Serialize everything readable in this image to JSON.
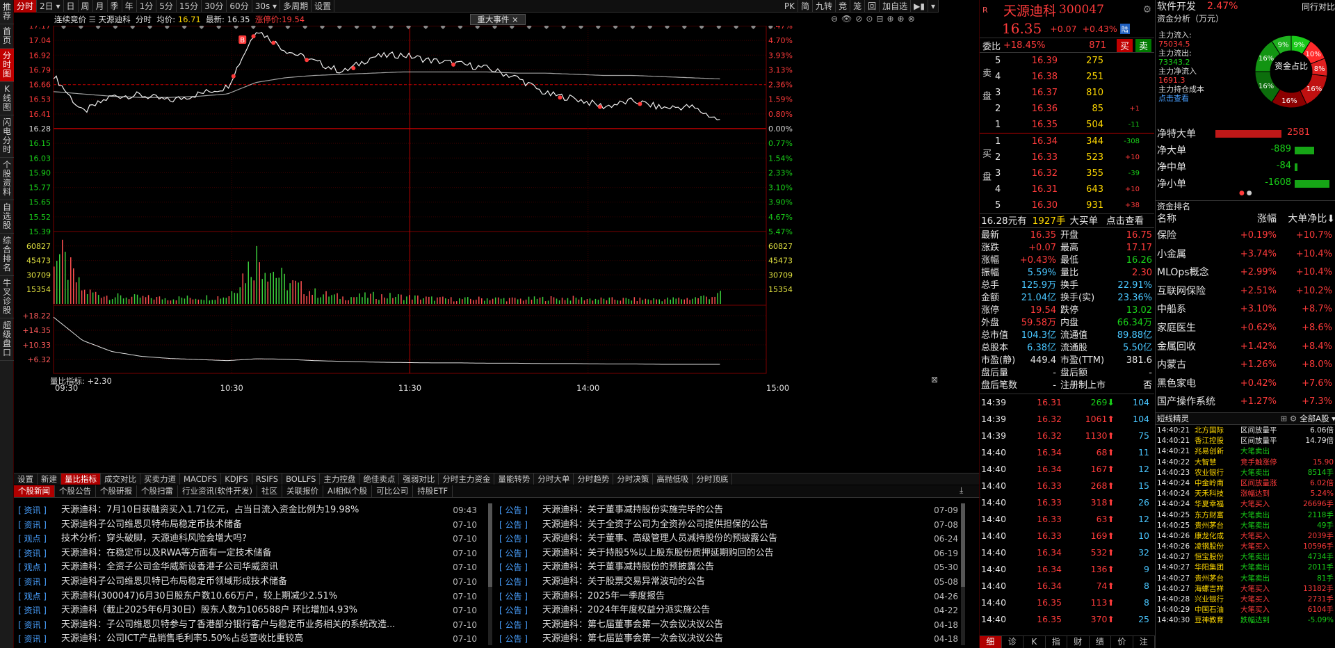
{
  "left_nav": [
    "推荐",
    "首页",
    "分时图",
    "K线图",
    "闪电分时",
    "个股资料",
    "自选股",
    "综合排名",
    "牛叉诊股",
    "超级盘口"
  ],
  "left_nav_active": 2,
  "topbar": {
    "tabs": [
      "分时",
      "2日",
      "日",
      "周",
      "月",
      "季",
      "年",
      "1分",
      "5分",
      "15分",
      "30分",
      "60分",
      "30s",
      "多周期",
      "设置"
    ],
    "active": 0,
    "right_tools": [
      "PK",
      "简",
      "九转",
      "竞",
      "笼",
      "回",
      "加自选"
    ]
  },
  "chart_info": {
    "mode": "连续竞价",
    "stock": "天源迪科",
    "label": "分时",
    "avg_label": "均价:",
    "avg": "16.71",
    "last_label": "最新:",
    "last": "16.35",
    "limit_label": "涨停价:",
    "limit": "19.54",
    "event_tag": "重大事件"
  },
  "price_axis": {
    "left": [
      "17.17",
      "17.04",
      "16.92",
      "16.79",
      "16.66",
      "16.53",
      "16.41",
      "16.28",
      "16.15",
      "16.03",
      "15.90",
      "15.77",
      "15.65",
      "15.52",
      "15.39"
    ],
    "right": [
      "5.47%",
      "4.70%",
      "3.93%",
      "3.13%",
      "2.36%",
      "1.59%",
      "0.80%",
      "0.00%",
      "0.77%",
      "1.54%",
      "2.33%",
      "3.10%",
      "3.90%",
      "4.67%",
      "5.47%"
    ],
    "prev_close": 16.28,
    "ymin": 15.39,
    "ymax": 17.17
  },
  "volume_axis": {
    "labels": [
      "60827",
      "45473",
      "30709",
      "15354"
    ],
    "vmax": 80000
  },
  "volratio": {
    "label": "量比指标: +2.30",
    "axis": [
      "+18.22",
      "+14.35",
      "+10.33",
      "+6.32"
    ]
  },
  "time_axis": [
    "09:30",
    "10:30",
    "11:30",
    "14:00",
    "15:00"
  ],
  "chart_data": {
    "type": "line",
    "x": [
      "09:30",
      "09:40",
      "09:50",
      "10:00",
      "10:10",
      "10:20",
      "10:30",
      "10:40",
      "10:50",
      "11:00",
      "11:10",
      "11:20",
      "11:30",
      "13:10",
      "13:20",
      "13:30",
      "13:40",
      "13:50",
      "14:00",
      "14:10",
      "14:20",
      "14:30",
      "14:40",
      "14:50"
    ],
    "series": [
      {
        "values": [
          16.74,
          16.42,
          16.56,
          16.57,
          16.52,
          16.58,
          16.64,
          17.14,
          16.96,
          16.86,
          16.77,
          16.9,
          16.92,
          16.87,
          16.84,
          16.8,
          16.72,
          16.58,
          16.54,
          16.47,
          16.52,
          16.46,
          16.47,
          16.35
        ]
      },
      {
        "values": [
          16.6,
          16.58,
          16.56,
          16.55,
          16.55,
          16.56,
          16.58,
          16.68,
          16.72,
          16.74,
          16.75,
          16.76,
          16.77,
          16.77,
          16.77,
          16.77,
          16.76,
          16.76,
          16.75,
          16.74,
          16.74,
          16.73,
          16.72,
          16.71
        ]
      },
      {
        "values": [
          62000,
          14000,
          8000,
          7000,
          6000,
          7000,
          8000,
          52000,
          24000,
          12000,
          7000,
          9000,
          8000,
          6000,
          5000,
          6000,
          5000,
          6000,
          6000,
          5000,
          5000,
          5000,
          6000,
          10000
        ]
      },
      {
        "values": [
          17.8,
          11.5,
          8.5,
          7.2,
          6.6,
          6.3,
          6.0,
          6.5,
          6.4,
          6.0,
          5.8,
          5.6,
          5.5,
          5.4,
          5.4,
          5.3,
          5.3,
          5.2,
          5.2,
          5.1,
          5.1,
          5.0,
          5.0,
          5.0
        ]
      }
    ]
  },
  "bottom_tabs": [
    "设置",
    "新建",
    "量比指标",
    "成交对比",
    "买卖力道",
    "MACDFS",
    "KDJFS",
    "RSIFS",
    "BOLLFS",
    "主力控盘",
    "绝佳卖点",
    "强弱对比",
    "分时主力资金",
    "量能转势",
    "分时大单",
    "分时趋势",
    "分时决策",
    "高抛低吸",
    "分时顶底"
  ],
  "bottom_tabs_active": 2,
  "news_tabs": [
    "个股新闻",
    "个股公告",
    "个股研报",
    "个股扫雷",
    "行业资讯(软件开发)",
    "社区",
    "关联报价",
    "AI相似个股",
    "可比公司",
    "持股ETF"
  ],
  "news_left": [
    {
      "tag": "[ 资讯 ]",
      "title": "天源迪科：7月10日获融资买入1.71亿元，占当日流入资金比例为19.98%",
      "date": "09:43"
    },
    {
      "tag": "[ 资讯 ]",
      "title": "天源迪科子公司维恩贝特布局稳定币技术储备",
      "date": "07-10"
    },
    {
      "tag": "[ 观点 ]",
      "title": "技术分析：穿头破脚，天源迪科风险会增大吗？",
      "date": "07-10"
    },
    {
      "tag": "[ 资讯 ]",
      "title": "天源迪科：在稳定币以及RWA等方面有一定技术储备",
      "date": "07-10"
    },
    {
      "tag": "[ 观点 ]",
      "title": "天源迪科：全资子公司金华威新设香港子公司华威资讯",
      "date": "07-10"
    },
    {
      "tag": "[ 资讯 ]",
      "title": "天源迪科子公司维恩贝特已布局稳定币领域形成技术储备",
      "date": "07-10"
    },
    {
      "tag": "[ 观点 ]",
      "title": "天源迪科(300047)6月30日股东户数10.66万户，较上期减少2.51%",
      "date": "07-10"
    },
    {
      "tag": "[ 资讯 ]",
      "title": "天源迪科（截止2025年6月30日）股东人数为106588户 环比增加4.93%",
      "date": "07-10"
    },
    {
      "tag": "[ 资讯 ]",
      "title": "天源迪科：子公司维恩贝特参与了香港部分银行客户与稳定币业务相关的系统改造...",
      "date": "07-10"
    },
    {
      "tag": "[ 资讯 ]",
      "title": "天源迪科：公司ICT产品销售毛利率5.50%占总营收比重较高",
      "date": "07-10"
    }
  ],
  "news_right": [
    {
      "tag": "[ 公告 ]",
      "title": "天源迪科：关于董事减持股份实施完毕的公告",
      "date": "07-09"
    },
    {
      "tag": "[ 公告 ]",
      "title": "天源迪科：关于全资子公司为全资孙公司提供担保的公告",
      "date": "07-08"
    },
    {
      "tag": "[ 公告 ]",
      "title": "天源迪科：关于董事、高级管理人员减持股份的预披露公告",
      "date": "06-24"
    },
    {
      "tag": "[ 公告 ]",
      "title": "天源迪科：关于持股5%以上股东股份质押延期购回的公告",
      "date": "06-19"
    },
    {
      "tag": "[ 公告 ]",
      "title": "天源迪科：关于董事减持股份的预披露公告",
      "date": "05-30"
    },
    {
      "tag": "[ 公告 ]",
      "title": "天源迪科：关于股票交易异常波动的公告",
      "date": "05-08"
    },
    {
      "tag": "[ 公告 ]",
      "title": "天源迪科：2025年一季度报告",
      "date": "04-26"
    },
    {
      "tag": "[ 公告 ]",
      "title": "天源迪科：2024年年度权益分派实施公告",
      "date": "04-22"
    },
    {
      "tag": "[ 公告 ]",
      "title": "天源迪科：第七届董事会第一次会议决议公告",
      "date": "04-18"
    },
    {
      "tag": "[ 公告 ]",
      "title": "天源迪科：第七届监事会第一次会议决议公告",
      "date": "04-18"
    }
  ],
  "quote": {
    "name": "天源迪科",
    "code": "300047",
    "price": "16.35",
    "chg": "+0.07",
    "pct": "+0.43%",
    "badge": "陆",
    "wb_label": "委比",
    "wb": "+18.45%",
    "wc": "871",
    "buy": "买",
    "sell": "卖",
    "sell_side": "卖盘",
    "buy_side": "买盘",
    "asks": [
      [
        "5",
        "16.39",
        "275",
        ""
      ],
      [
        "4",
        "16.38",
        "251",
        ""
      ],
      [
        "3",
        "16.37",
        "810",
        ""
      ],
      [
        "2",
        "16.36",
        "85",
        "+1"
      ],
      [
        "1",
        "16.35",
        "504",
        "-11"
      ]
    ],
    "bids": [
      [
        "1",
        "16.34",
        "344",
        "-308"
      ],
      [
        "2",
        "16.33",
        "523",
        "+10"
      ],
      [
        "3",
        "16.32",
        "355",
        "-39"
      ],
      [
        "4",
        "16.31",
        "643",
        "+10"
      ],
      [
        "5",
        "16.30",
        "931",
        "+38"
      ]
    ],
    "bigbuy": "16.28元有",
    "bigvol": "1927手",
    "bigtxt": "大买单",
    "bigclick": "点击查看",
    "stats": [
      [
        "最新",
        "16.35",
        "开盘",
        "16.75"
      ],
      [
        "涨跌",
        "+0.07",
        "最高",
        "17.17"
      ],
      [
        "涨幅",
        "+0.43%",
        "最低",
        "16.26"
      ],
      [
        "振幅",
        "5.59%",
        "量比",
        "2.30"
      ],
      [
        "总手",
        "125.9万",
        "换手",
        "22.91%"
      ],
      [
        "金额",
        "21.04亿",
        "换手(实)",
        "23.36%"
      ],
      [
        "涨停",
        "19.54",
        "跌停",
        "13.02"
      ],
      [
        "外盘",
        "59.58万",
        "内盘",
        "66.34万"
      ],
      [
        "总市值",
        "104.3亿",
        "流通值",
        "89.88亿"
      ],
      [
        "总股本",
        "6.38亿",
        "流通股",
        "5.50亿"
      ],
      [
        "市盈(静)",
        "449.4",
        "市盈(TTM)",
        "381.6"
      ],
      [
        "盘后量",
        "-",
        "盘后额",
        "-"
      ],
      [
        "盘后笔数",
        "-",
        "注册制上市",
        "否"
      ]
    ],
    "ticks": [
      [
        "14:39",
        "16.31",
        "269",
        "104"
      ],
      [
        "14:39",
        "16.32",
        "1061",
        "104"
      ],
      [
        "14:39",
        "16.32",
        "1130",
        "75"
      ],
      [
        "14:40",
        "16.34",
        "68",
        "11"
      ],
      [
        "14:40",
        "16.34",
        "167",
        "12"
      ],
      [
        "14:40",
        "16.33",
        "268",
        "15"
      ],
      [
        "14:40",
        "16.33",
        "318",
        "26"
      ],
      [
        "14:40",
        "16.33",
        "63",
        "12"
      ],
      [
        "14:40",
        "16.33",
        "169",
        "10"
      ],
      [
        "14:40",
        "16.34",
        "532",
        "32"
      ],
      [
        "14:40",
        "16.34",
        "136",
        "9"
      ],
      [
        "14:40",
        "16.34",
        "74",
        "8"
      ],
      [
        "14:40",
        "16.35",
        "113",
        "8"
      ],
      [
        "14:40",
        "16.35",
        "370",
        "25"
      ]
    ],
    "bottom_tabs": [
      "细",
      "诊",
      "K",
      "指",
      "财",
      "绩",
      "价",
      "注"
    ]
  },
  "right": {
    "sector": "软件开发",
    "sector_pct": "2.47%",
    "compare": "同行对比",
    "fund_title": "资金分析（万元）",
    "fund_rows": [
      [
        "主力流入:",
        "75034.5"
      ],
      [
        "主力流出:",
        "73343.2"
      ],
      [
        "主力净流入",
        "1691.3"
      ],
      [
        "主力持仓成本",
        ""
      ]
    ],
    "click": "点击查看",
    "donut_center": "资金占比",
    "donut": [
      [
        "9%",
        "#19c919"
      ],
      [
        "10%",
        "#ff2a2a"
      ],
      [
        "8%",
        "#e02020"
      ],
      [
        "16%",
        "#c01010"
      ],
      [
        "16%",
        "#8b0000"
      ],
      [
        "16%",
        "#0c6e0c"
      ],
      [
        "16%",
        "#129412"
      ],
      [
        "9%",
        "#1fb11f"
      ]
    ],
    "netflow": [
      [
        "净特大单",
        "2581",
        "red",
        0.95
      ],
      [
        "净大单",
        "-889",
        "green",
        0.35
      ],
      [
        "净中单",
        "-84",
        "green",
        0.05
      ],
      [
        "净小单",
        "-1608",
        "green",
        0.62
      ]
    ],
    "rank_title": "资金排名",
    "rank_headers": [
      "名称",
      "涨幅",
      "大单净比"
    ],
    "ranks": [
      [
        "保险",
        "+0.19%",
        "+10.7%"
      ],
      [
        "小金属",
        "+3.74%",
        "+10.4%"
      ],
      [
        "MLOps概念",
        "+2.99%",
        "+10.4%"
      ],
      [
        "互联网保险",
        "+2.51%",
        "+10.2%"
      ],
      [
        "中船系",
        "+3.10%",
        "+8.7%"
      ],
      [
        "家庭医生",
        "+0.62%",
        "+8.6%"
      ],
      [
        "金属回收",
        "+1.42%",
        "+8.4%"
      ],
      [
        "内蒙古",
        "+1.26%",
        "+8.0%"
      ],
      [
        "黑色家电",
        "+0.42%",
        "+7.6%"
      ],
      [
        "国产操作系统",
        "+1.27%",
        "+7.3%"
      ]
    ],
    "short_title": "短线精灵",
    "short_filter": "全部A股",
    "shorts": [
      [
        "14:40:21",
        "北方国际",
        "区间放量平",
        "6.06倍",
        "white"
      ],
      [
        "14:40:21",
        "香江控股",
        "区间放量平",
        "14.79倍",
        "white"
      ],
      [
        "14:40:21",
        "兆易创新",
        "大笔卖出",
        "",
        "green"
      ],
      [
        "14:40:22",
        "大智慧",
        "竞手触涨停",
        "15.90",
        "red"
      ],
      [
        "14:40:23",
        "农业银行",
        "大笔卖出",
        "8514手",
        "green"
      ],
      [
        "14:40:24",
        "中金岭南",
        "区间放量涨",
        "6.02倍",
        "red"
      ],
      [
        "14:40:24",
        "天禾科技",
        "涨幅达到",
        "5.24%",
        "red"
      ],
      [
        "14:40:24",
        "华夏幸福",
        "大笔买入",
        "26696手",
        "red"
      ],
      [
        "14:40:25",
        "东方财富",
        "大笔卖出",
        "2118手",
        "green"
      ],
      [
        "14:40:25",
        "贵州茅台",
        "大笔卖出",
        "49手",
        "green"
      ],
      [
        "14:40:26",
        "康龙化成",
        "大笔买入",
        "2039手",
        "red"
      ],
      [
        "14:40:26",
        "凌钢股份",
        "大笔买入",
        "10596手",
        "red"
      ],
      [
        "14:40:27",
        "恒宝股份",
        "大笔卖出",
        "4734手",
        "green"
      ],
      [
        "14:40:27",
        "华阳集团",
        "大笔卖出",
        "2011手",
        "green"
      ],
      [
        "14:40:27",
        "贵州茅台",
        "大笔卖出",
        "81手",
        "green"
      ],
      [
        "14:40:27",
        "海螺吉祥",
        "大笔买入",
        "13182手",
        "red"
      ],
      [
        "14:40:28",
        "兴业银行",
        "大笔买入",
        "2731手",
        "red"
      ],
      [
        "14:40:29",
        "中国石油",
        "大笔买入",
        "6104手",
        "red"
      ],
      [
        "14:40:30",
        "豆神教育",
        "跌幅达到",
        "-5.09%",
        "green"
      ]
    ]
  },
  "colors": {
    "up": "#ff3b3b",
    "down": "#19d119",
    "accent": "#b00000",
    "avg": "#e8e8e8",
    "price": "#f0f0f0"
  }
}
